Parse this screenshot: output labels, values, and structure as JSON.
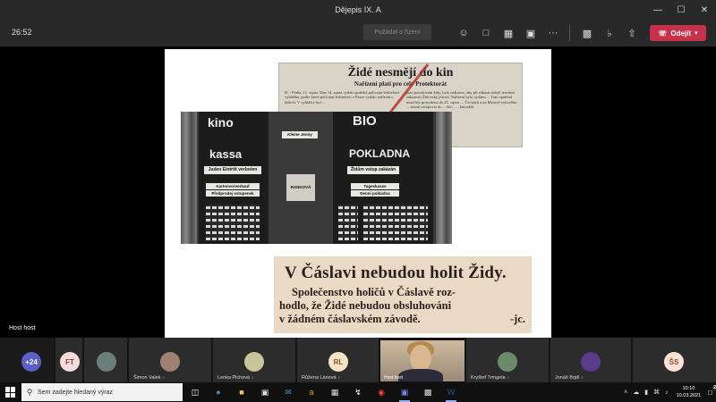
{
  "window": {
    "title": "Dějepis IX. A"
  },
  "toolbar": {
    "timer": "26:52",
    "raise_hand_label": "Požádat o řízení",
    "leave_label": "Odejít"
  },
  "presenter": {
    "name": "Host host"
  },
  "slide": {
    "clip1": {
      "headline": "Židé nesmějí do kin",
      "subheadline": "Nařízení platí pro celý Protektorát",
      "col1": "H. - Praha, 11. srpna. Dne 14. srpna vydalo pražské policejní ředitelství vyhlášku, podle které policejní ředitelství v Praze vydalo nařízení o židech. V vyhlášce byl ...",
      "col2": "jsou považováni židy, bylo nařízeno, aby při zákazu nebyli uvedeni zákazníci Židovský původ. Nařízení bylo vydáno ... Tato opatření musí být provedena do 25. srpna. ... Čechách a na Moravě vyhověno ... nesmí vstupovat do ... žid... ... kinosálů."
    },
    "photo": {
      "signs": {
        "kino": "kino",
        "bio": "BIO",
        "kassa": "kassa",
        "pokladna": "POKLADNA",
        "juden": "Juden Eintritt verboten",
        "zidum": "Židům vstup zakázán",
        "vorverkauf": "Kartenvorverkauf",
        "predprodej": "Předprodej vstupenek",
        "tageskasse": "Tageskasse",
        "denni": "Denní pokladna",
        "movie": "Kleine Jenny",
        "rankova": "RANKOVÁ"
      }
    },
    "clip2": {
      "headline": "V Čáslavi nebudou holit Židy.",
      "line1": "Společenstvo holičů v Čáslavě roz-",
      "line2": "hodlo, že Židé nebudou obsluhováni",
      "line3": "v žádném čáslavském závodě.",
      "signature": "-jc."
    }
  },
  "participants": {
    "overflow_count": "+24",
    "tiles": [
      {
        "initials": "FT",
        "name": "",
        "color": "#f4dcdc",
        "text": "#8a3a3a"
      },
      {
        "initials": "",
        "name": "",
        "photo": "#6b7f7a"
      },
      {
        "initials": "",
        "name": "Šimon Valek",
        "photo": "#a08070"
      },
      {
        "initials": "",
        "name": "Lenka Plchová",
        "photo": "#c9c49a"
      },
      {
        "initials": "RL",
        "name": "Růžena Lánová",
        "color": "#f5e3c4",
        "text": "#7a5a2a"
      },
      {
        "initials": "",
        "name": "Host host",
        "video": true
      },
      {
        "initials": "",
        "name": "Kryštof Trmgela",
        "photo": "#6a8a6a"
      },
      {
        "initials": "",
        "name": "Jonáš Brjdl",
        "photo": "#5a3b8c"
      },
      {
        "initials": "ŠS",
        "name": "",
        "color": "#fbe3d8",
        "text": "#9a4a2a"
      }
    ]
  },
  "taskbar": {
    "search_placeholder": "Sem zadejte hledaný výraz",
    "time": "10:10",
    "date": "10.03.2021",
    "notifications": "2"
  }
}
